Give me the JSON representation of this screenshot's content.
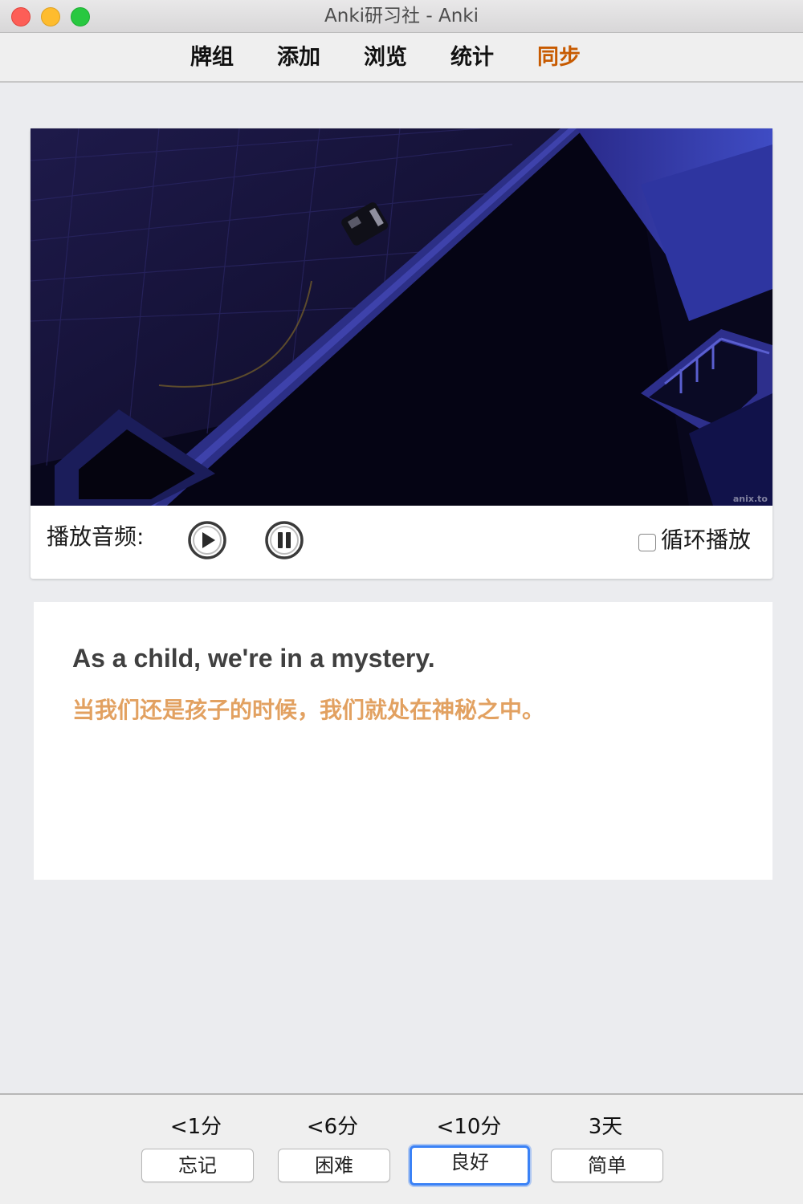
{
  "window": {
    "title": "Anki研习社 - Anki"
  },
  "nav": {
    "items": [
      {
        "label": "牌组"
      },
      {
        "label": "添加"
      },
      {
        "label": "浏览"
      },
      {
        "label": "统计"
      },
      {
        "label": "同步",
        "active": true
      }
    ],
    "active_color": "#c75a00"
  },
  "video": {
    "watermark": "anix.to"
  },
  "audio_controls": {
    "label": "播放音频:",
    "loop_label": "循环播放",
    "loop_checked": false,
    "icons": [
      "play-icon",
      "pause-icon"
    ]
  },
  "card": {
    "english": "As a child, we're in a mystery.",
    "chinese": "当我们还是孩子的时候，我们就处在神秘之中。",
    "chinese_color": "#e2a161"
  },
  "answers": [
    {
      "interval": "<1分",
      "label": "忘记"
    },
    {
      "interval": "<6分",
      "label": "困难"
    },
    {
      "interval": "<10分",
      "label": "良好",
      "focused": true
    },
    {
      "interval": "3天",
      "label": "简单"
    }
  ],
  "colors": {
    "focus_ring": "#3b82f6",
    "background": "#ebecef"
  }
}
